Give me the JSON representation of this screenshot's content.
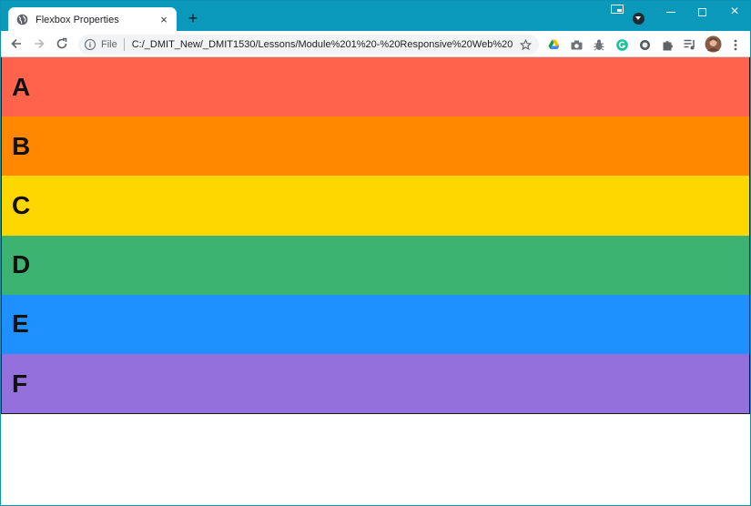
{
  "browser": {
    "tab_title": "Flexbox Properties",
    "tab_close": "×",
    "new_tab": "+",
    "url_scheme": "File",
    "url": "C:/_DMIT_New/_DMIT1530/Lessons/Module%201%20-%20Responsive%20Web%20D...",
    "window_buttons": {
      "minimize": "minimize",
      "maximize": "maximize",
      "close": "×"
    }
  },
  "icons": {
    "back": "back-arrow-icon",
    "forward": "forward-arrow-icon",
    "reload": "reload-icon",
    "info": "info-icon",
    "star": "bookmark-star-icon",
    "extensions": [
      "google-drive-icon",
      "camera-icon",
      "bug-icon",
      "grammarly-icon",
      "circle-extension-icon",
      "puzzle-icon",
      "reading-list-icon",
      "profile-avatar-icon",
      "menu-dots-icon"
    ]
  },
  "page": {
    "boxes": [
      {
        "label": "A",
        "color": "#ff634b"
      },
      {
        "label": "B",
        "color": "#ff8800"
      },
      {
        "label": "C",
        "color": "#ffd700"
      },
      {
        "label": "D",
        "color": "#3cb371"
      },
      {
        "label": "E",
        "color": "#1e90ff"
      },
      {
        "label": "F",
        "color": "#9370db"
      }
    ]
  }
}
